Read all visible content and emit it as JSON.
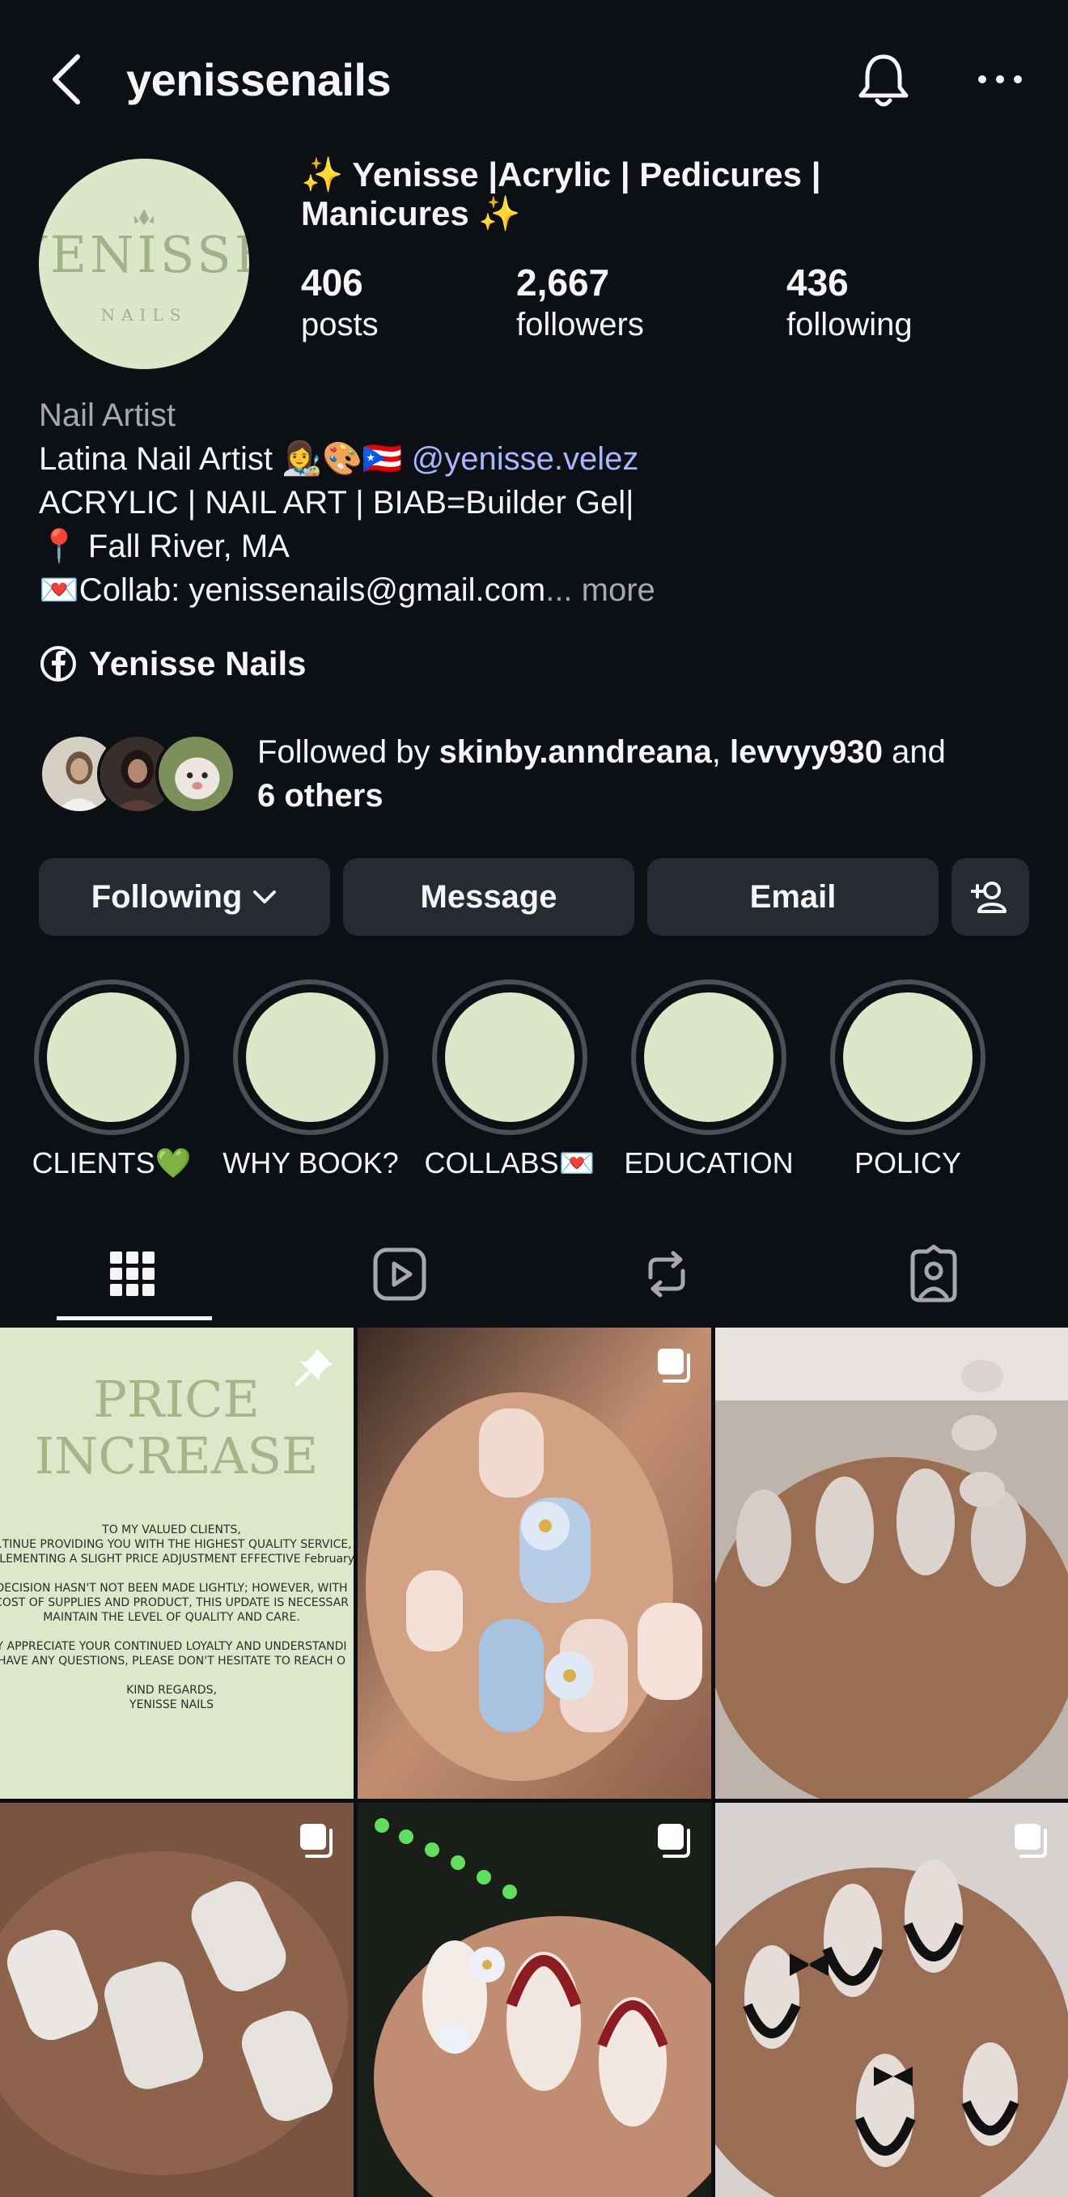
{
  "header": {
    "username": "yenissenails"
  },
  "profile": {
    "avatar_wordmark": "YENISSE",
    "avatar_sub": "NAILS",
    "display_name": "✨ Yenisse |Acrylic | Pedicures | Manicures ✨",
    "stats": [
      {
        "value": "406",
        "label": "posts"
      },
      {
        "value": "2,667",
        "label": "followers"
      },
      {
        "value": "436",
        "label": "following"
      }
    ]
  },
  "bio": {
    "category": "Nail Artist",
    "line1": "Latina Nail Artist 👩‍🎨🎨🇵🇷 ",
    "mention": "@yenisse.velez",
    "line2": "ACRYLIC | NAIL ART | BIAB=Builder Gel|",
    "line3": "📍 Fall River, MA",
    "line4": "💌Collab: yenissenails@gmail.com",
    "ellipsis": "...",
    "more": " more",
    "facebook_label": "Yenisse Nails"
  },
  "followed_by": {
    "prefix": "Followed by ",
    "user1": "skinby.anndreana",
    "sep": ", ",
    "user2": "levvyy930",
    "and": " and",
    "others": "6 others"
  },
  "actions": {
    "following": "Following",
    "message": "Message",
    "email": "Email"
  },
  "highlights": [
    {
      "label": "CLIENTS💚"
    },
    {
      "label": "WHY BOOK?"
    },
    {
      "label": "COLLABS💌"
    },
    {
      "label": "EDUCATION"
    },
    {
      "label": "POLICY"
    }
  ],
  "posts": {
    "price_title1": "PRICE",
    "price_title2": "INCREASE",
    "price_p1": "TO MY VALUED CLIENTS,",
    "price_p2": "...TINUE PROVIDING YOU WITH THE HIGHEST QUALITY SERVICE,",
    "price_p3": "...LEMENTING A SLIGHT PRICE ADJUSTMENT EFFECTIVE February",
    "price_p4": "DECISION HASN'T NOT BEEN MADE LIGHTLY; HOWEVER, WITH",
    "price_p5": "COST OF SUPPLIES AND PRODUCT, THIS UPDATE IS NECESSAR",
    "price_p6": "MAINTAIN THE LEVEL OF QUALITY AND CARE.",
    "price_p7": "Y APPRECIATE YOUR CONTINUED LOYALTY AND UNDERSTANDI",
    "price_p8": "HAVE ANY QUESTIONS, PLEASE DON'T HESITATE TO REACH O",
    "price_p9": "KIND REGARDS,",
    "price_p10": "YENISSE NAILS"
  },
  "colors": {
    "background": "#0c1014",
    "button": "#262a31",
    "mention": "#a6b6ff",
    "brand_green": "#dce6c9",
    "brand_text": "#9fb28a"
  }
}
